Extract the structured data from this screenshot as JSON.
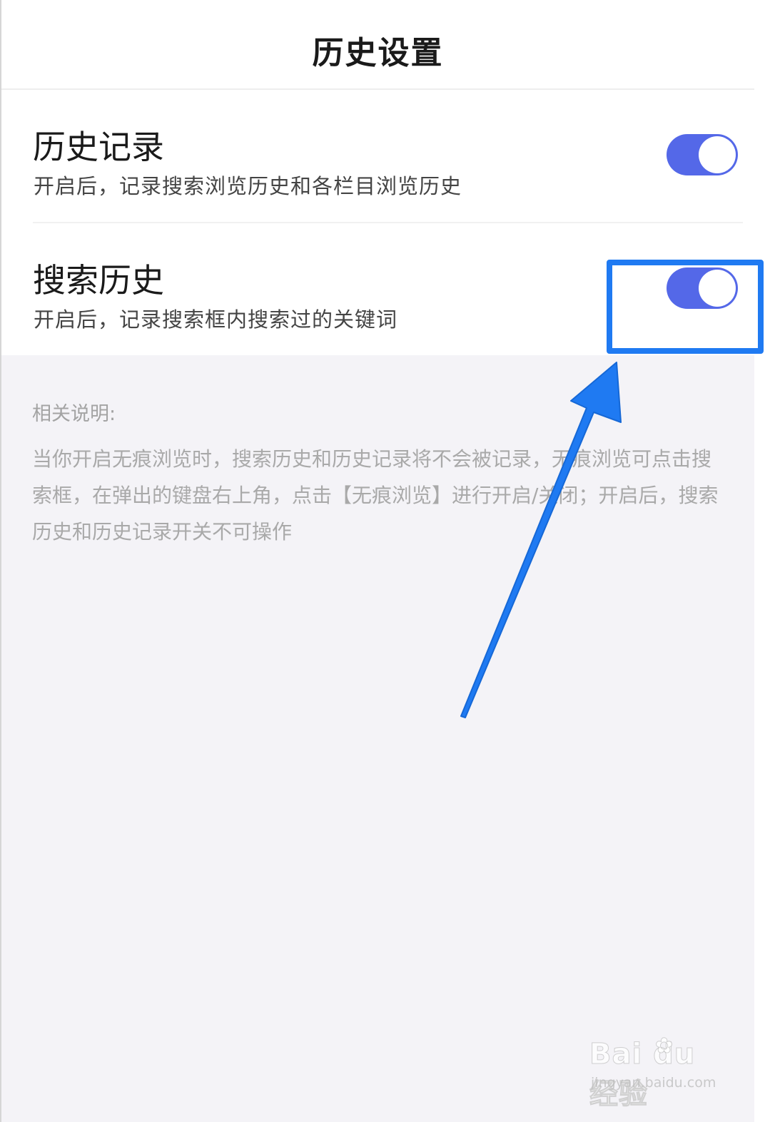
{
  "header": {
    "title": "历史设置"
  },
  "settings": [
    {
      "label": "历史记录",
      "description": "开启后，记录搜索浏览历史和各栏目浏览历史",
      "enabled": true
    },
    {
      "label": "搜索历史",
      "description": "开启后，记录搜索框内搜索过的关键词",
      "enabled": true
    }
  ],
  "info": {
    "heading": "相关说明:",
    "body": "当你开启无痕浏览时，搜索历史和历史记录将不会被记录，无痕浏览可点击搜索框，在弹出的键盘右上角，点击【无痕浏览】进行开启/关闭；开启后，搜索历史和历史记录开关不可操作"
  },
  "annotation": {
    "color": "#1f7af2"
  },
  "watermark": {
    "brand": "Bai du 经验",
    "url": "jingyan.baidu.com"
  },
  "colors": {
    "toggle_on": "#5468e8",
    "info_bg": "#f4f3f7"
  }
}
